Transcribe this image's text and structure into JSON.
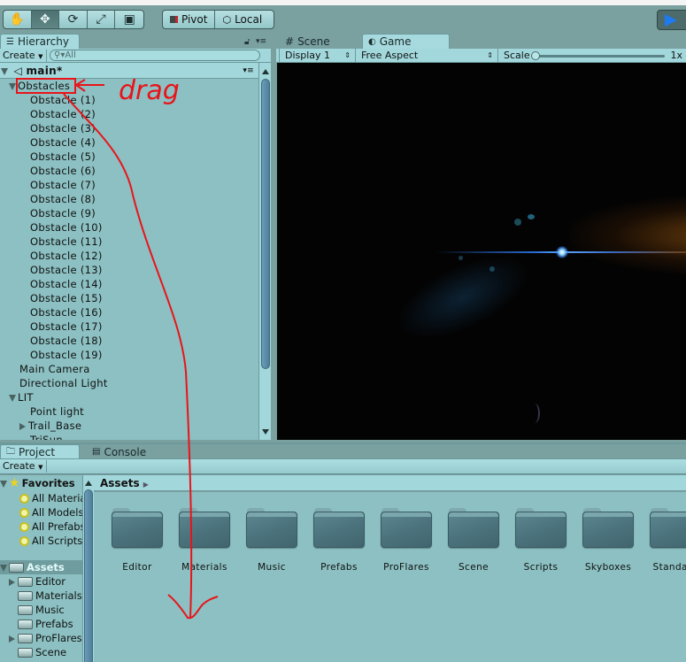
{
  "toolbar": {
    "tools": [
      {
        "name": "hand-tool",
        "glyph": "✋",
        "active": false
      },
      {
        "name": "move-tool",
        "glyph": "✥",
        "active": true
      },
      {
        "name": "rotate-tool",
        "glyph": "⟳",
        "active": false
      },
      {
        "name": "scale-tool",
        "glyph": "⤢",
        "active": false
      },
      {
        "name": "rect-tool",
        "glyph": "▣",
        "active": false
      }
    ],
    "pivot_label": "Pivot",
    "local_label": "Local",
    "play_color": "#1e7af0"
  },
  "hierarchy": {
    "tab_label": "Hierarchy",
    "create_label": "Create",
    "search_placeholder": "All",
    "scene_name": "main*",
    "items": [
      {
        "label": "Obstacles",
        "indent": 1,
        "expander": "down"
      },
      {
        "label": "Obstacle (1)",
        "indent": 2
      },
      {
        "label": "Obstacle (2)",
        "indent": 2
      },
      {
        "label": "Obstacle (3)",
        "indent": 2
      },
      {
        "label": "Obstacle (4)",
        "indent": 2
      },
      {
        "label": "Obstacle (5)",
        "indent": 2
      },
      {
        "label": "Obstacle (6)",
        "indent": 2
      },
      {
        "label": "Obstacle (7)",
        "indent": 2
      },
      {
        "label": "Obstacle (8)",
        "indent": 2
      },
      {
        "label": "Obstacle (9)",
        "indent": 2
      },
      {
        "label": "Obstacle (10)",
        "indent": 2
      },
      {
        "label": "Obstacle (11)",
        "indent": 2
      },
      {
        "label": "Obstacle (12)",
        "indent": 2
      },
      {
        "label": "Obstacle (13)",
        "indent": 2
      },
      {
        "label": "Obstacle (14)",
        "indent": 2
      },
      {
        "label": "Obstacle (15)",
        "indent": 2
      },
      {
        "label": "Obstacle (16)",
        "indent": 2
      },
      {
        "label": "Obstacle (17)",
        "indent": 2
      },
      {
        "label": "Obstacle (18)",
        "indent": 2
      },
      {
        "label": "Obstacle (19)",
        "indent": 2
      },
      {
        "label": "Main Camera",
        "indent": 1
      },
      {
        "label": "Directional Light",
        "indent": 1
      },
      {
        "label": "LIT",
        "indent": 1,
        "expander": "down"
      },
      {
        "label": "Point light",
        "indent": 2
      },
      {
        "label": "Trail_Base",
        "indent": 2,
        "expander": "right"
      },
      {
        "label": "TriSun",
        "indent": 2
      }
    ]
  },
  "game": {
    "scene_tab_label": "Scene",
    "game_tab_label": "Game",
    "display_label": "Display 1",
    "aspect_label": "Free Aspect",
    "scale_label": "Scale",
    "scale_value": "1x"
  },
  "project": {
    "project_tab_label": "Project",
    "console_tab_label": "Console",
    "create_label": "Create",
    "favorites_label": "Favorites",
    "favorites": [
      "All Materials",
      "All Models",
      "All Prefabs",
      "All Scripts"
    ],
    "assets_label": "Assets",
    "tree": [
      {
        "label": "Editor",
        "expander": "right"
      },
      {
        "label": "Materials"
      },
      {
        "label": "Music"
      },
      {
        "label": "Prefabs"
      },
      {
        "label": "ProFlares",
        "expander": "right"
      },
      {
        "label": "Scene"
      }
    ],
    "breadcrumb": "Assets",
    "folders": [
      "Editor",
      "Materials",
      "Music",
      "Prefabs",
      "ProFlares",
      "Scene",
      "Scripts",
      "Skyboxes",
      "Standard"
    ]
  },
  "annotation": {
    "text": "drag",
    "color": "#e8141a"
  }
}
